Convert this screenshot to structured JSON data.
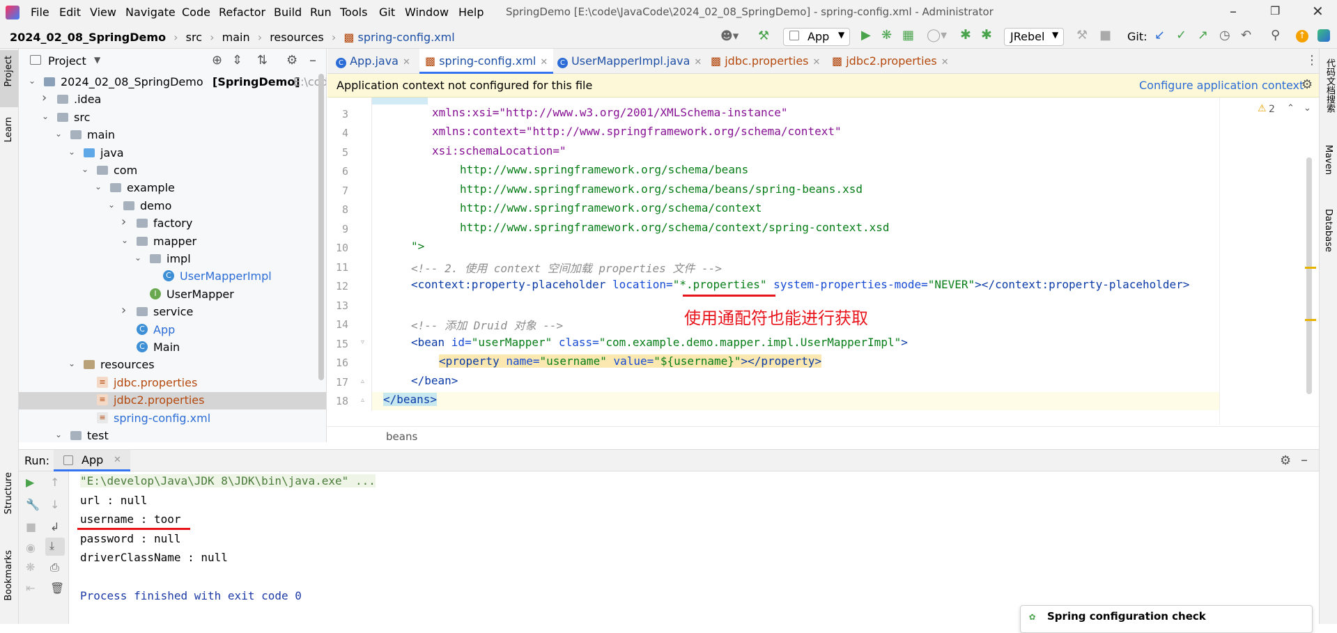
{
  "menubar": {
    "items": [
      "File",
      "Edit",
      "View",
      "Navigate",
      "Code",
      "Refactor",
      "Build",
      "Run",
      "Tools",
      "Git",
      "Window",
      "Help"
    ],
    "window_title": "SpringDemo [E:\\code\\JavaCode\\2024_02_08_SpringDemo] - spring-config.xml - Administrator"
  },
  "breadcrumb": [
    "2024_02_08_SpringDemo",
    "src",
    "main",
    "resources",
    "spring-config.xml"
  ],
  "toolbar": {
    "run_config": "App",
    "jrebel": "JRebel",
    "git_label": "Git:"
  },
  "left_strip": {
    "project": "Project",
    "learn": "Learn",
    "structure": "Structure",
    "bookmarks": "Bookmarks"
  },
  "right_strip": {
    "plugin": "代码文档搜索",
    "maven": "Maven",
    "database": "Database"
  },
  "project_panel": {
    "title": "Project",
    "tree": [
      {
        "label": "2024_02_08_SpringDemo",
        "bold_suffix": "[SpringDemo]",
        "path": "E:\\code\\Java",
        "indent": 0,
        "arrow": "open",
        "icon": "module"
      },
      {
        "label": ".idea",
        "indent": 1,
        "arrow": "closed",
        "icon": "folder"
      },
      {
        "label": "src",
        "indent": 1,
        "arrow": "open",
        "icon": "folder"
      },
      {
        "label": "main",
        "indent": 2,
        "arrow": "open",
        "icon": "folder"
      },
      {
        "label": "java",
        "indent": 3,
        "arrow": "open",
        "icon": "src-folder"
      },
      {
        "label": "com",
        "indent": 4,
        "arrow": "open",
        "icon": "folder"
      },
      {
        "label": "example",
        "indent": 5,
        "arrow": "open",
        "icon": "folder"
      },
      {
        "label": "demo",
        "indent": 6,
        "arrow": "open",
        "icon": "folder"
      },
      {
        "label": "factory",
        "indent": 7,
        "arrow": "closed",
        "icon": "folder"
      },
      {
        "label": "mapper",
        "indent": 7,
        "arrow": "open",
        "icon": "folder"
      },
      {
        "label": "impl",
        "indent": 8,
        "arrow": "open",
        "icon": "folder"
      },
      {
        "label": "UserMapperImpl",
        "indent": 9,
        "arrow": "none",
        "icon": "class",
        "color": "#2b6cd6"
      },
      {
        "label": "UserMapper",
        "indent": 8,
        "arrow": "none",
        "icon": "interface"
      },
      {
        "label": "service",
        "indent": 7,
        "arrow": "closed",
        "icon": "folder"
      },
      {
        "label": "App",
        "indent": 7,
        "arrow": "none",
        "icon": "main-class",
        "color": "#2b6cd6"
      },
      {
        "label": "Main",
        "indent": 7,
        "arrow": "none",
        "icon": "main-class"
      },
      {
        "label": "resources",
        "indent": 3,
        "arrow": "open",
        "icon": "res-folder"
      },
      {
        "label": "jdbc.properties",
        "indent": 4,
        "arrow": "none",
        "icon": "properties",
        "color": "#b4480d"
      },
      {
        "label": "jdbc2.properties",
        "indent": 4,
        "arrow": "none",
        "icon": "properties",
        "color": "#b4480d",
        "selected": true
      },
      {
        "label": "spring-config.xml",
        "indent": 4,
        "arrow": "none",
        "icon": "xml",
        "color": "#2b6cd6"
      },
      {
        "label": "test",
        "indent": 2,
        "arrow": "open",
        "icon": "folder"
      }
    ]
  },
  "editor": {
    "tabs": [
      {
        "label": "App.java",
        "icon": "class",
        "color": "#1c4fa5"
      },
      {
        "label": "spring-config.xml",
        "icon": "xml",
        "color": "#1c4fa5",
        "active": true
      },
      {
        "label": "UserMapperImpl.java",
        "icon": "class",
        "color": "#1c4fa5"
      },
      {
        "label": "jdbc.properties",
        "icon": "properties",
        "color": "#b4480d"
      },
      {
        "label": "jdbc2.properties",
        "icon": "properties",
        "color": "#b4480d"
      }
    ],
    "banner_text": "Application context not configured for this file",
    "banner_link": "Configure application context",
    "warnings": "2",
    "line_numbers": [
      "3",
      "4",
      "5",
      "6",
      "7",
      "8",
      "9",
      "10",
      "11",
      "12",
      "13",
      "14",
      "15",
      "16",
      "17",
      "18"
    ],
    "lines": {
      "l3": "xmlns:xsi=\"http://www.w3.org/2001/XMLSchema-instance\"",
      "l4": "xmlns:context=\"http://www.springframework.org/schema/context\"",
      "l5": "xsi:schemaLocation=\"",
      "l6": "http://www.springframework.org/schema/beans",
      "l7": "http://www.springframework.org/schema/beans/spring-beans.xsd",
      "l8": "http://www.springframework.org/schema/context",
      "l9": "http://www.springframework.org/schema/context/spring-context.xsd",
      "l10": "\">",
      "l11": "<!-- 2. 使用 context 空间加载 properties 文件 -->",
      "l12_open": "<context:property-placeholder ",
      "l12_loc_attr": "location=",
      "l12_loc_val": "\"*.properties\"",
      "l12_mode_attr": " system-properties-mode=",
      "l12_mode_val": "\"NEVER\"",
      "l12_close": "></context:property-placeholder>",
      "l14": "<!-- 添加 Druid 对象 -->",
      "l15_tag": "<bean ",
      "l15_id_attr": "id=",
      "l15_id_val": "\"userMapper\"",
      "l15_class_attr": " class=",
      "l15_class_val": "\"com.example.demo.mapper.impl.UserMapperImpl\"",
      "l15_end": ">",
      "l16_tag": "<property ",
      "l16_name_attr": "name=",
      "l16_name_val": "\"username\"",
      "l16_value_attr": " value=",
      "l16_value_val": "\"${username}\"",
      "l16_end": "></property>",
      "l17": "</bean>",
      "l18": "</beans>"
    },
    "annotation": "使用通配符也能进行获取",
    "crumb": "beans"
  },
  "run_panel": {
    "label": "Run:",
    "tab": "App",
    "output": [
      "\"E:\\develop\\Java\\JDK 8\\JDK\\bin\\java.exe\" ...",
      "url : null",
      "username : toor",
      "password : null",
      "driverClassName : null",
      "",
      "Process finished with exit code 0"
    ],
    "notification": "Spring configuration check"
  },
  "colors": {
    "accent": "#2b6cd6",
    "annotation_red": "#e8141c",
    "selection": "#d5d5d5",
    "banner_bg": "#fdf8d7"
  }
}
